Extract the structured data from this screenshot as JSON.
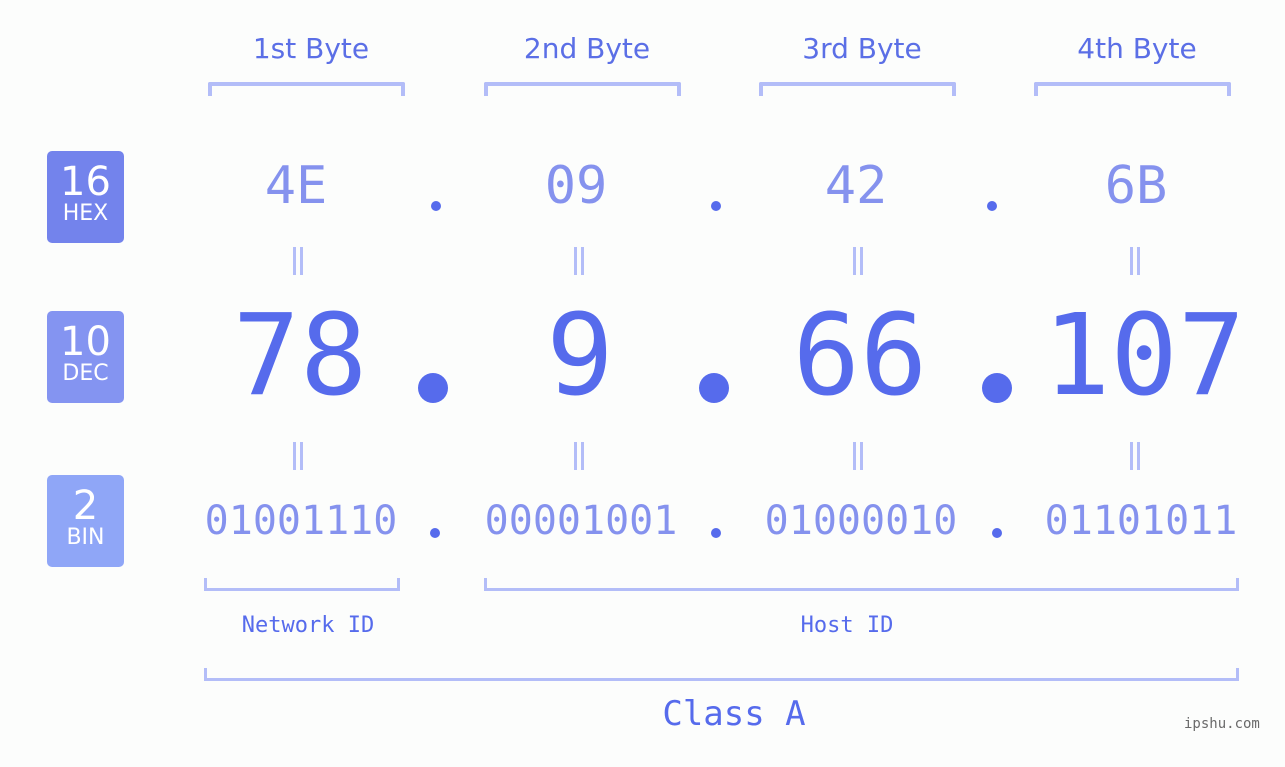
{
  "ip_address": "78.9.66.107",
  "bytes": [
    {
      "header": "1st Byte",
      "hex": "4E",
      "dec": "78",
      "bin": "01001110"
    },
    {
      "header": "2nd Byte",
      "hex": "09",
      "dec": "9",
      "bin": "00001001"
    },
    {
      "header": "3rd Byte",
      "hex": "42",
      "dec": "66",
      "bin": "01000010"
    },
    {
      "header": "4th Byte",
      "hex": "6B",
      "dec": "107",
      "bin": "01101011"
    }
  ],
  "separator": ".",
  "badges": {
    "hex": {
      "num": "16",
      "label": "HEX",
      "color": "#7383ec"
    },
    "dec": {
      "num": "10",
      "label": "DEC",
      "color": "#8494f1"
    },
    "bin": {
      "num": "2",
      "label": "BIN",
      "color": "#8fa6f7"
    }
  },
  "segments": {
    "network": "Network ID",
    "host": "Host ID"
  },
  "class_label": "Class A",
  "watermark": "ipshu.com",
  "colors": {
    "primary": "#566bec",
    "light": "#8592ee",
    "bracket": "#b3bdf8",
    "background": "#fcfdfc"
  }
}
